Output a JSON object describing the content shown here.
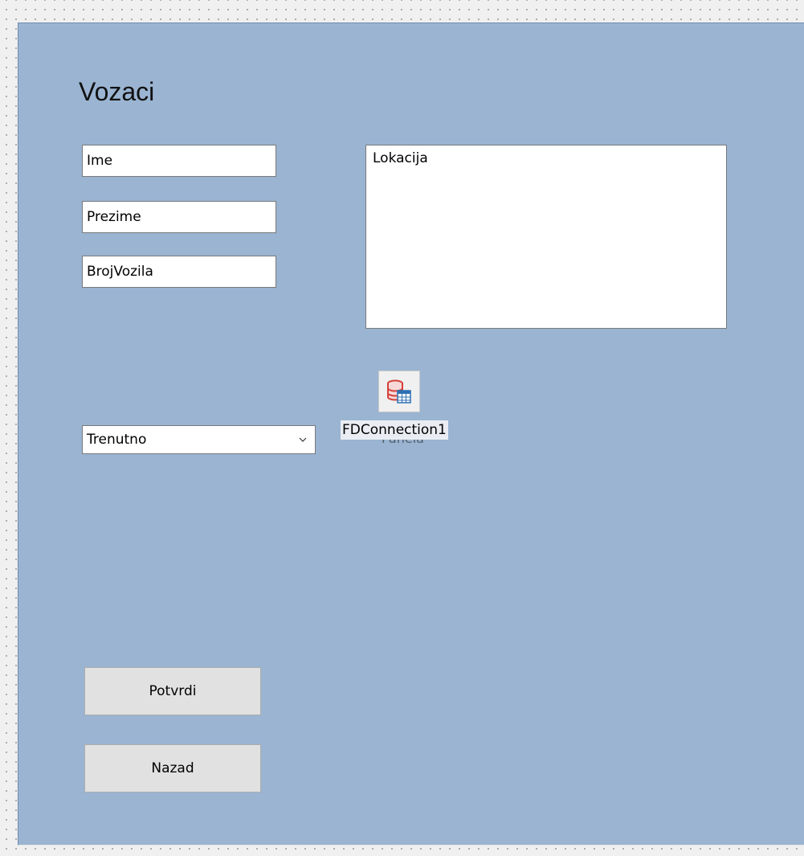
{
  "form": {
    "title": "Vozaci"
  },
  "fields": {
    "ime": "Ime",
    "prezime": "Prezime",
    "broj_vozila": "BrojVozila",
    "lokacija": "Lokacija"
  },
  "combo": {
    "selected": "Trenutno"
  },
  "component": {
    "icon": "database-connection-icon",
    "name": "FDConnection1",
    "hidden_caption": "Panela"
  },
  "buttons": {
    "potvrdi": "Potvrdi",
    "nazad": "Nazad"
  },
  "colors": {
    "form_background": "#9ab4d2",
    "designer_background": "#f0f0f0",
    "button_face": "#e1e1e1"
  }
}
